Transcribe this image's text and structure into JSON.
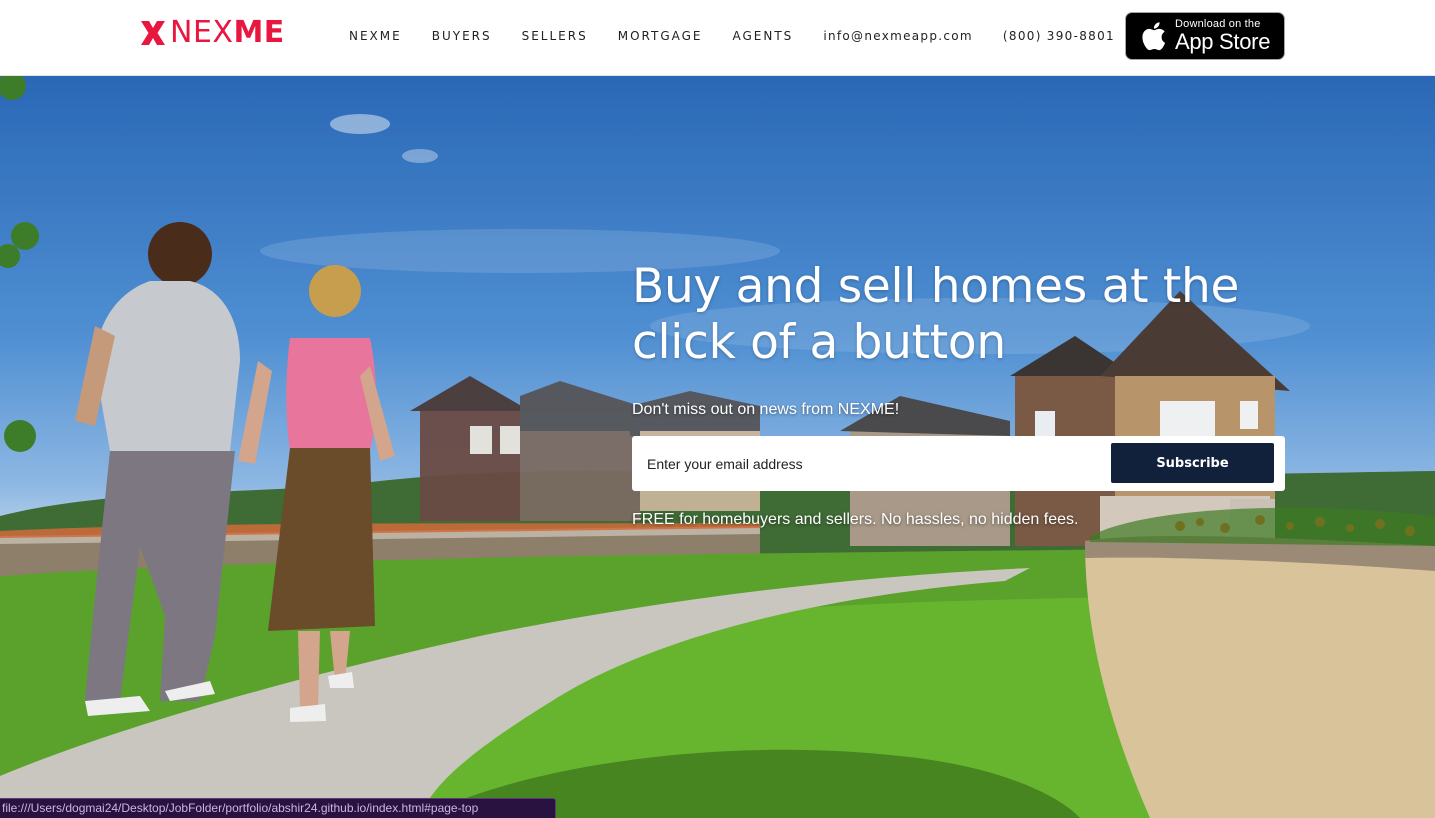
{
  "header": {
    "logo": {
      "prefix": "NEX",
      "suffix": "ME",
      "icon": "nexme-x-mark-icon"
    },
    "nav": [
      {
        "label": "NEXME"
      },
      {
        "label": "BUYERS"
      },
      {
        "label": "SELLERS"
      },
      {
        "label": "MORTGAGE"
      },
      {
        "label": "AGENTS"
      },
      {
        "label": "info@nexmeapp.com"
      },
      {
        "label": "(800) 390-8801"
      }
    ],
    "app_store": {
      "line1": "Download on the",
      "line2": "App Store",
      "icon": "apple-icon"
    }
  },
  "hero": {
    "title": "Buy and sell homes at the click of a button",
    "subtitle": "Don't miss out on news from NEXME!",
    "email": {
      "placeholder": "Enter your email address",
      "value": ""
    },
    "subscribe_label": "Subscribe",
    "note": "FREE for homebuyers and sellers. No hassles, no hidden fees."
  },
  "status_bar": {
    "url": "file:///Users/dogmai24/Desktop/JobFolder/portfolio/abshir24.github.io/index.html#page-top"
  },
  "colors": {
    "brand": "#e8173f",
    "button": "#12213b",
    "status_bg": "#2a1240"
  }
}
